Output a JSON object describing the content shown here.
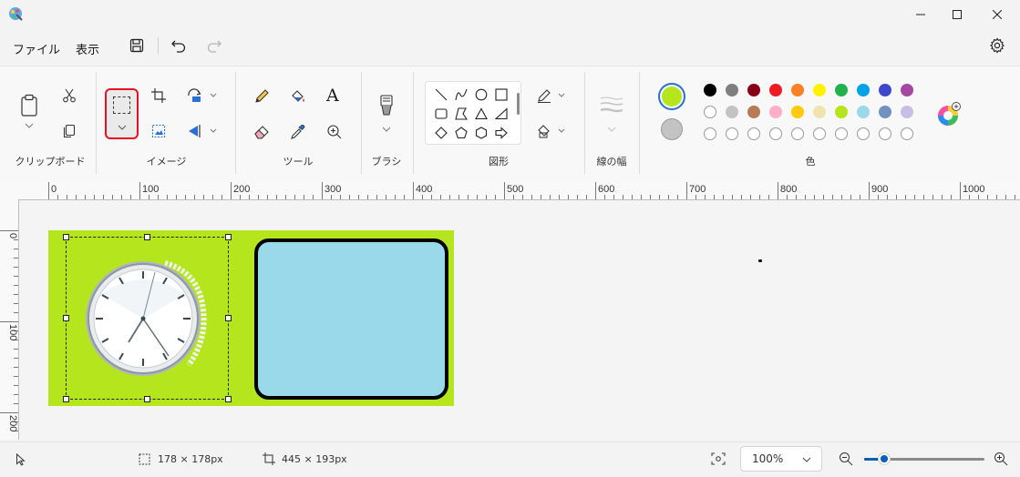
{
  "menu": {
    "file_label": "ファイル",
    "view_label": "表示"
  },
  "ribbon": {
    "groups": {
      "clipboard": "クリップボード",
      "image": "イメージ",
      "tools": "ツール",
      "brush": "ブラシ",
      "shapes": "図形",
      "line_width": "線の幅",
      "colors": "色"
    },
    "text_tool_glyph": "A",
    "primary_color": "#b5e61d",
    "secondary_color": "#c3c3c3",
    "palette_row1": [
      "#000000",
      "#7f7f7f",
      "#880015",
      "#ed1c24",
      "#ff7f27",
      "#fff200",
      "#22b14c",
      "#00a2e8",
      "#3f48cc",
      "#a349a4"
    ],
    "palette_row2": [
      "#ffffff",
      "#c3c3c3",
      "#b97a57",
      "#ffaec9",
      "#ffc90e",
      "#efe4b0",
      "#b5e61d",
      "#99d9ea",
      "#7092be",
      "#c8bfe7"
    ]
  },
  "ruler": {
    "h_ticks": [
      "0",
      "100",
      "200",
      "300",
      "400",
      "500",
      "600",
      "700",
      "800",
      "900",
      "1000"
    ],
    "v_ticks": [
      "0",
      "100",
      "200"
    ]
  },
  "canvas": {
    "background_color": "#b5e61d",
    "rect_fill": "#99d9ea",
    "rect_stroke": "#000000"
  },
  "status": {
    "selection_size": "178 × 178px",
    "canvas_size": "445 × 193px",
    "zoom": "100%",
    "zoom_level_fraction": 0.17
  }
}
